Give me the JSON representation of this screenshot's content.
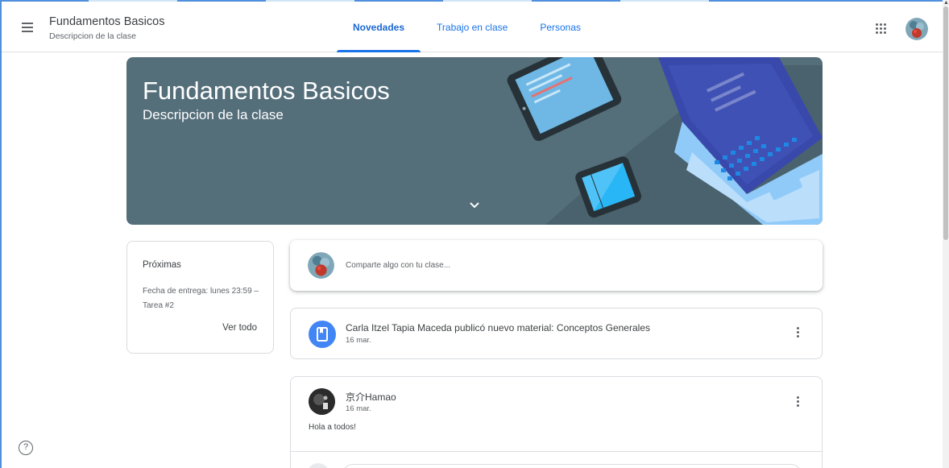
{
  "header": {
    "class_title": "Fundamentos Basicos",
    "class_subtitle": "Descripcion de la clase",
    "tabs": [
      {
        "label": "Novedades",
        "active": true
      },
      {
        "label": "Trabajo en clase",
        "active": false
      },
      {
        "label": "Personas",
        "active": false
      }
    ]
  },
  "banner": {
    "title": "Fundamentos Basicos",
    "subtitle": "Descripcion de la clase",
    "color": "#546e7a"
  },
  "upcoming": {
    "title": "Próximas",
    "due_text": "Fecha de entrega: lunes 23:59 – Tarea #2",
    "view_all": "Ver todo"
  },
  "share": {
    "placeholder": "Comparte algo con tu clase..."
  },
  "stream": [
    {
      "type": "material",
      "text": "Carla Itzel Tapia Maceda publicó nuevo material: Conceptos Generales",
      "date": "16 mar."
    },
    {
      "type": "post",
      "author": "京介Hamao",
      "date": "16 mar.",
      "body": "Hola a todos!"
    }
  ],
  "icons": {
    "menu": "menu-icon",
    "apps": "apps-grid-icon",
    "help": "help-icon",
    "more": "more-vert-icon",
    "material": "book-icon",
    "expand": "chevron-down-icon"
  },
  "colors": {
    "accent": "#1a73e8",
    "material_icon_bg": "#4285f4"
  }
}
